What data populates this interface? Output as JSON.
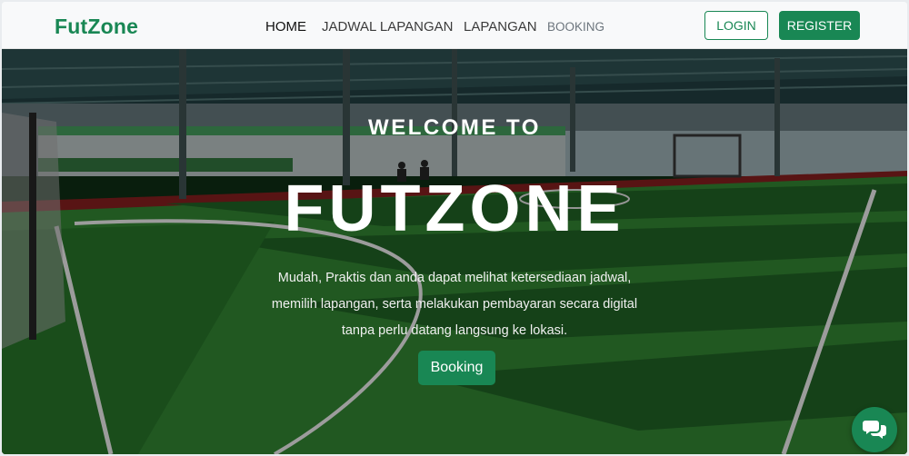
{
  "navbar": {
    "brand": "FutZone",
    "links": [
      {
        "label": "HOME"
      },
      {
        "label": "JADWAL LAPANGAN"
      },
      {
        "label": "LAPANGAN"
      },
      {
        "label": "BOOKING"
      }
    ],
    "login_label": "LOGIN",
    "register_label": "REGISTER"
  },
  "hero": {
    "welcome": "WELCOME TO",
    "title": "FUTZONE",
    "description_lines": [
      "Mudah, Praktis dan anda dapat melihat ketersediaan jadwal,",
      "memilih lapangan, serta melakukan pembayaran secara digital",
      "tanpa perlu datang langsung ke lokasi."
    ],
    "booking_label": "Booking"
  },
  "chat": {
    "icon": "chat-bubbles-icon"
  },
  "colors": {
    "accent": "#198754",
    "navbar_bg": "#f8f9fa"
  }
}
